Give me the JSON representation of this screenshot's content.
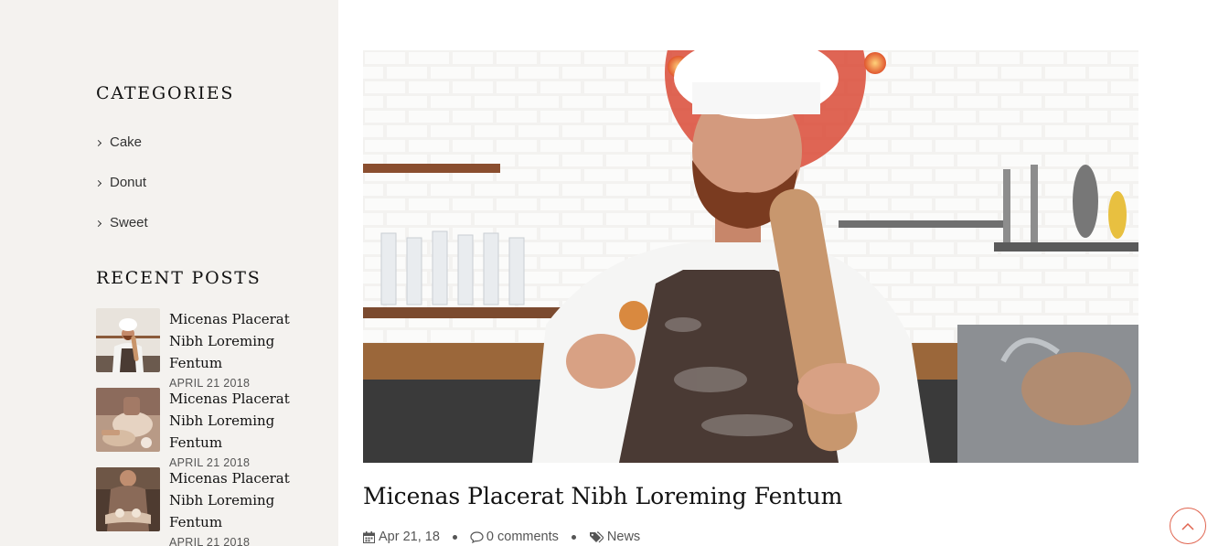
{
  "sidebar": {
    "categories_title": "CATEGORIES",
    "categories": [
      {
        "label": "Cake"
      },
      {
        "label": "Donut"
      },
      {
        "label": "Sweet"
      }
    ],
    "recent_title": "RECENT POSTS",
    "recent_posts": [
      {
        "title": "Micenas Placerat Nibh Loreming Fentum",
        "date": "APRIL 21 2018"
      },
      {
        "title": "Micenas Placerat Nibh Loreming Fentum",
        "date": "APRIL 21 2018"
      },
      {
        "title": "Micenas Placerat Nibh Loreming Fentum",
        "date": "APRIL 21 2018"
      }
    ]
  },
  "post": {
    "title": "Micenas Placerat Nibh Loreming Fentum",
    "date": "Apr 21, 18",
    "comments": "0 comments",
    "category": "News"
  },
  "icons": {
    "chevron": "chevron-right-icon",
    "calendar": "calendar-icon",
    "comment": "comment-icon",
    "tags": "tags-icon",
    "back_to_top": "chevron-up-icon"
  },
  "colors": {
    "sidebar_bg": "#f4f2ef",
    "accent": "#e0644f",
    "heading": "#111111",
    "text": "#333333"
  }
}
